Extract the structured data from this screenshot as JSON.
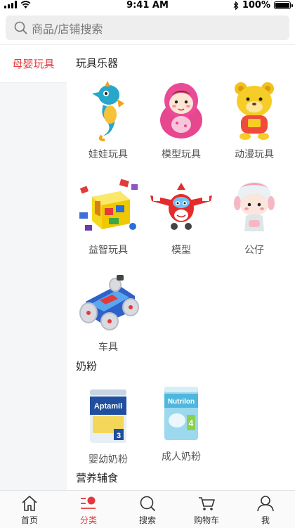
{
  "status_bar": {
    "time": "9:41 AM",
    "battery": "100%"
  },
  "search": {
    "placeholder": "商品/店铺搜索"
  },
  "sidebar": {
    "items": [
      {
        "label": "母婴玩具",
        "active": true
      }
    ]
  },
  "content": {
    "sections": [
      {
        "title": "玩具乐器",
        "items": [
          {
            "label": "娃娃玩具",
            "icon": "seahorse-toy-image"
          },
          {
            "label": "模型玩具",
            "icon": "roly-poly-doll-image"
          },
          {
            "label": "动漫玩具",
            "icon": "bear-toy-image"
          },
          {
            "label": "益智玩具",
            "icon": "building-blocks-image"
          },
          {
            "label": "模型",
            "icon": "toy-airplane-image"
          },
          {
            "label": "公仔",
            "icon": "figure-doll-image"
          },
          {
            "label": "车具",
            "icon": "stunt-car-image"
          }
        ]
      },
      {
        "title": "奶粉",
        "items": [
          {
            "label": "婴幼奶粉",
            "icon": "aptamil-can-image",
            "brand": "Aptamil",
            "stage": "3"
          },
          {
            "label": "成人奶粉",
            "icon": "nutrilon-can-image",
            "brand": "Nutrilon",
            "stage": "4"
          }
        ]
      },
      {
        "title": "营养辅食",
        "items": []
      }
    ]
  },
  "tabbar": {
    "tabs": [
      {
        "label": "首页",
        "icon": "home-icon",
        "active": false
      },
      {
        "label": "分类",
        "icon": "category-icon",
        "active": true
      },
      {
        "label": "搜索",
        "icon": "search-icon",
        "active": false
      },
      {
        "label": "购物车",
        "icon": "cart-icon",
        "active": false
      },
      {
        "label": "我",
        "icon": "user-icon",
        "active": false
      }
    ]
  },
  "colors": {
    "accent": "#e4393c",
    "sidebar_bg": "#f5f6f8",
    "search_bg": "#eeeeee"
  }
}
